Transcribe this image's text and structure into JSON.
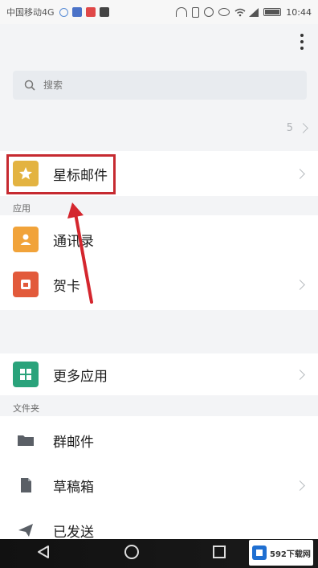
{
  "status_bar": {
    "carrier": "中国移动4G",
    "time": "10:44"
  },
  "search": {
    "placeholder": "搜索"
  },
  "count_row": {
    "value": "5"
  },
  "starred": {
    "label": "星标邮件"
  },
  "apps": {
    "section_label": "应用",
    "items": [
      {
        "label": "通讯录",
        "icon": "contacts-icon"
      },
      {
        "label": "贺卡",
        "icon": "greeting-card-icon"
      },
      {
        "label": "更多应用",
        "icon": "more-apps-icon"
      }
    ]
  },
  "folders": {
    "section_label": "文件夹",
    "items": [
      {
        "label": "群邮件",
        "icon": "folder-icon"
      },
      {
        "label": "草稿箱",
        "icon": "draft-icon"
      },
      {
        "label": "已发送",
        "icon": "sent-icon"
      }
    ]
  },
  "watermark": {
    "text": "592下载网"
  },
  "colors": {
    "highlight": "#c62a30",
    "star_icon": "#e3b341",
    "contacts_icon": "#f1a33a",
    "greeting_icon": "#e25a3b",
    "more_apps_icon": "#2aa37b",
    "folder_icon": "#5a5f66"
  }
}
